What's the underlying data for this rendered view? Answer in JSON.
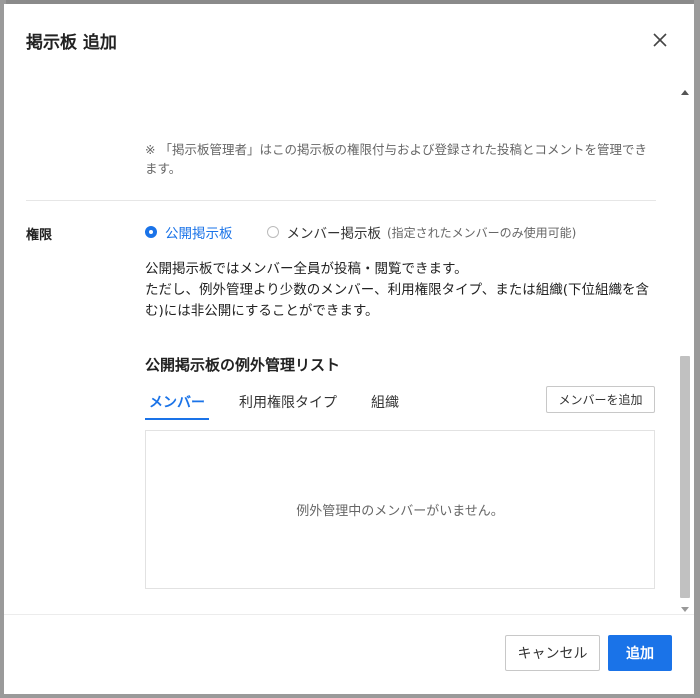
{
  "dialog": {
    "title": "掲示板 追加",
    "close_icon": "close-icon"
  },
  "note": {
    "text": "※ 「掲示板管理者」はこの掲示板の権限付与および登録された投稿とコメントを管理できます。"
  },
  "permission": {
    "label": "権限",
    "options": [
      {
        "label": "公開掲示板",
        "selected": true
      },
      {
        "label": "メンバー掲示板",
        "hint": "(指定されたメンバーのみ使用可能)",
        "selected": false
      }
    ],
    "description_line1": "公開掲示板ではメンバー全員が投稿・閲覧できます。",
    "description_line2": "ただし、例外管理より少数のメンバー、利用権限タイプ、または組織(下位組織を含む)には非公開にすることができます。"
  },
  "exception_list": {
    "title": "公開掲示板の例外管理リスト",
    "tabs": [
      {
        "label": "メンバー",
        "active": true
      },
      {
        "label": "利用権限タイプ",
        "active": false
      },
      {
        "label": "組織",
        "active": false
      }
    ],
    "add_button": "メンバーを追加",
    "empty_message": "例外管理中のメンバーがいません。"
  },
  "footer": {
    "cancel_label": "キャンセル",
    "submit_label": "追加"
  },
  "colors": {
    "accent": "#1a73e8"
  }
}
